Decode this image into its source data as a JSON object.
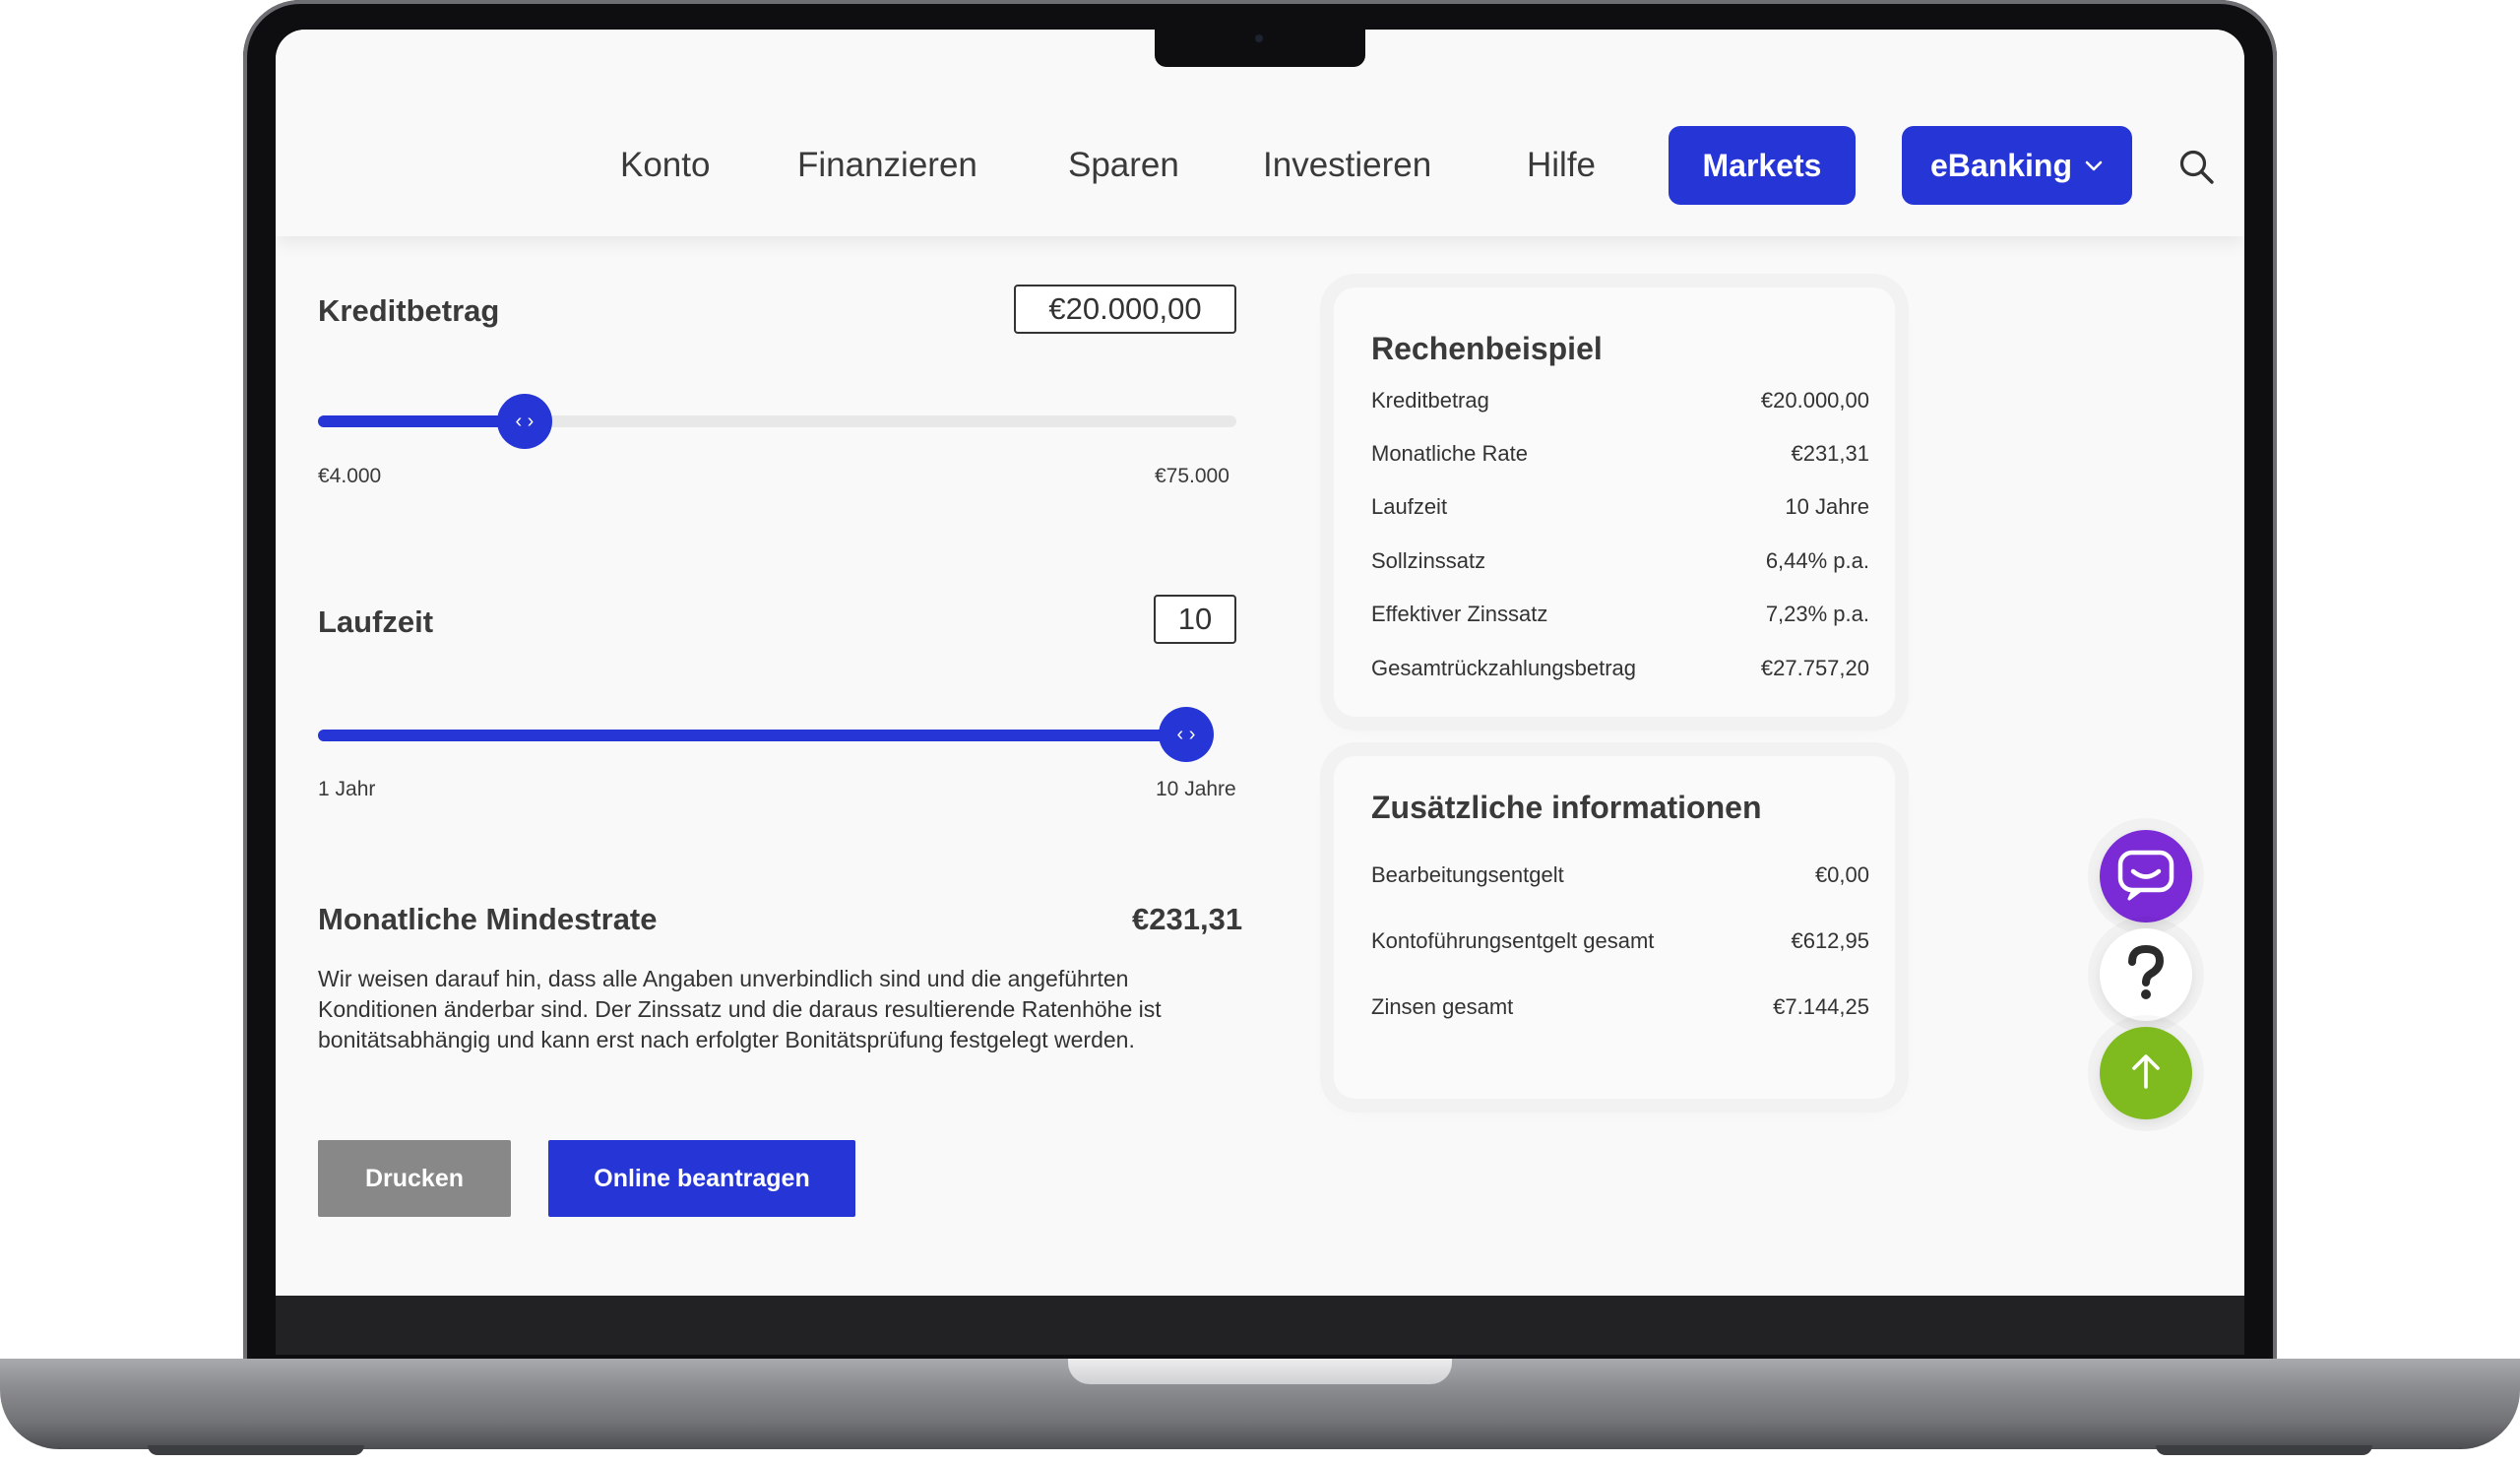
{
  "nav": {
    "items": [
      "Konto",
      "Finanzieren",
      "Sparen",
      "Investieren",
      "Hilfe"
    ],
    "markets_label": "Markets",
    "ebanking_label": "eBanking"
  },
  "calculator": {
    "amount_label": "Kreditbetrag",
    "amount_value": "€20.000,00",
    "amount_min": "€4.000",
    "amount_max": "€75.000",
    "amount_slider_fraction": 0.225,
    "term_label": "Laufzeit",
    "term_value": "10",
    "term_min": "1 Jahr",
    "term_max": "10 Jahre",
    "term_slider_fraction": 1.0,
    "rate_label": "Monatliche Mindestrate",
    "rate_value": "€231,31",
    "disclaimer": "Wir weisen darauf hin, dass alle Angaben unverbindlich sind und die angeführten Konditionen änderbar sind. Der Zinssatz und die daraus resultierende Ratenhöhe ist bonitätsabhängig und kann erst nach erfolgter Bonitätsprüfung festgelegt werden.",
    "print_label": "Drucken",
    "apply_label": "Online beantragen"
  },
  "example": {
    "title": "Rechenbeispiel",
    "rows": [
      {
        "label": "Kreditbetrag",
        "value": "€20.000,00"
      },
      {
        "label": "Monatliche Rate",
        "value": "€231,31"
      },
      {
        "label": "Laufzeit",
        "value": "10 Jahre"
      },
      {
        "label": "Sollzinssatz",
        "value": "6,44% p.a."
      },
      {
        "label": "Effektiver Zinssatz",
        "value": "7,23% p.a."
      },
      {
        "label": "Gesamtrückzahlungsbetrag",
        "value": "€27.757,20"
      }
    ]
  },
  "info": {
    "title": "Zusätzliche informationen",
    "rows": [
      {
        "label": "Bearbeitungsentgelt",
        "value": "€0,00"
      },
      {
        "label": "Kontoführungsentgelt gesamt",
        "value": "€612,95"
      },
      {
        "label": "Zinsen gesamt",
        "value": "€7.144,25"
      }
    ]
  },
  "colors": {
    "primary": "#2535d6",
    "chat": "#7a2bd6",
    "scroll_top": "#7fbb1e",
    "print_button": "#888888"
  },
  "icons": {
    "search": "search-icon",
    "chevron": "chevron-down-icon",
    "slider_handle": "slider-handle-icon",
    "chat": "chat-icon",
    "help": "question-mark-icon",
    "scroll_top": "arrow-up-icon"
  }
}
